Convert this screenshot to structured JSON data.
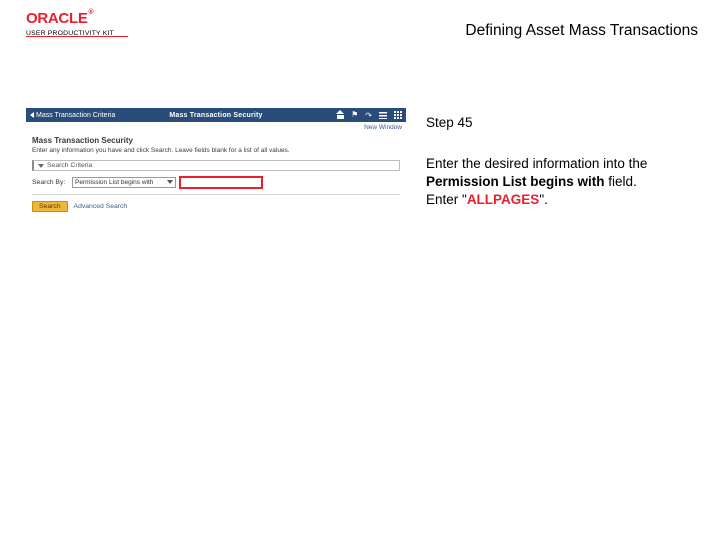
{
  "header": {
    "logo_text": "ORACLE",
    "logo_tm": "®",
    "logo_sub": "USER PRODUCTIVITY KIT",
    "doc_title": "Defining Asset Mass Transactions"
  },
  "step": {
    "label": "Step 45"
  },
  "instruction": {
    "line1": "Enter the desired information into the ",
    "bold_field": "Permission List begins with",
    "line1_tail": " field.",
    "line2_pre": "Enter \"",
    "value": "ALLPAGES",
    "line2_post": "\"."
  },
  "shot": {
    "back_label": "Mass Transaction Criteria",
    "title": "Mass Transaction Security",
    "new_window": "New Window",
    "page_heading": "Mass Transaction Security",
    "help_text": "Enter any information you have and click Search. Leave fields blank for a list of all values.",
    "criteria_header": "Search Criteria",
    "search_by_label": "Search By:",
    "search_by_value": "Permission List begins with",
    "search_btn": "Search",
    "adv_link": "Advanced Search"
  }
}
